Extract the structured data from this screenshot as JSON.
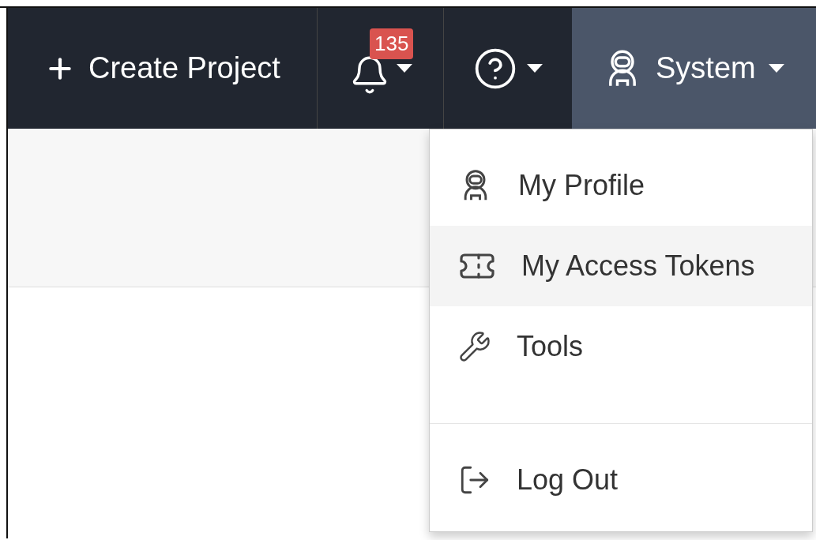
{
  "navbar": {
    "create_button": {
      "label": "Create Project"
    },
    "notifications": {
      "badge": "135"
    },
    "user_menu": {
      "label": "System",
      "expanded": true
    }
  },
  "dropdown": {
    "items": [
      {
        "label": "My Profile",
        "highlighted": false
      },
      {
        "label": "My Access Tokens",
        "highlighted": true
      },
      {
        "label": "Tools",
        "highlighted": false
      }
    ],
    "footer_items": [
      {
        "label": "Log Out",
        "highlighted": false
      }
    ]
  }
}
